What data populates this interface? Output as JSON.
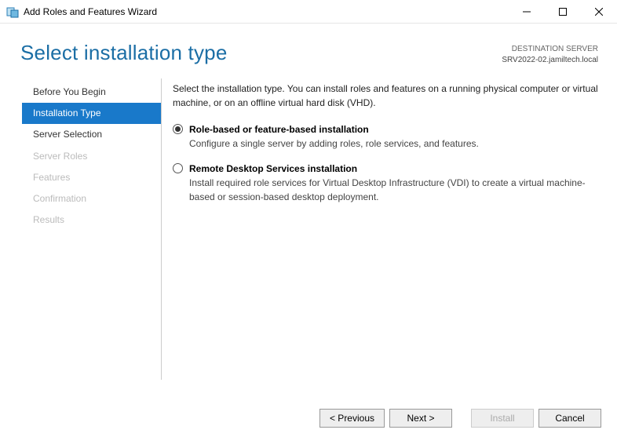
{
  "window": {
    "title": "Add Roles and Features Wizard"
  },
  "header": {
    "page_title": "Select installation type",
    "destination_label": "DESTINATION SERVER",
    "destination_server": "SRV2022-02.jamiltech.local"
  },
  "sidebar": {
    "items": [
      {
        "label": "Before You Begin",
        "state": "enabled"
      },
      {
        "label": "Installation Type",
        "state": "active"
      },
      {
        "label": "Server Selection",
        "state": "enabled"
      },
      {
        "label": "Server Roles",
        "state": "disabled"
      },
      {
        "label": "Features",
        "state": "disabled"
      },
      {
        "label": "Confirmation",
        "state": "disabled"
      },
      {
        "label": "Results",
        "state": "disabled"
      }
    ]
  },
  "main": {
    "intro": "Select the installation type. You can install roles and features on a running physical computer or virtual machine, or on an offline virtual hard disk (VHD).",
    "options": [
      {
        "title": "Role-based or feature-based installation",
        "desc": "Configure a single server by adding roles, role services, and features.",
        "selected": true
      },
      {
        "title": "Remote Desktop Services installation",
        "desc": "Install required role services for Virtual Desktop Infrastructure (VDI) to create a virtual machine-based or session-based desktop deployment.",
        "selected": false
      }
    ]
  },
  "footer": {
    "previous": "< Previous",
    "next": "Next >",
    "install": "Install",
    "cancel": "Cancel"
  }
}
